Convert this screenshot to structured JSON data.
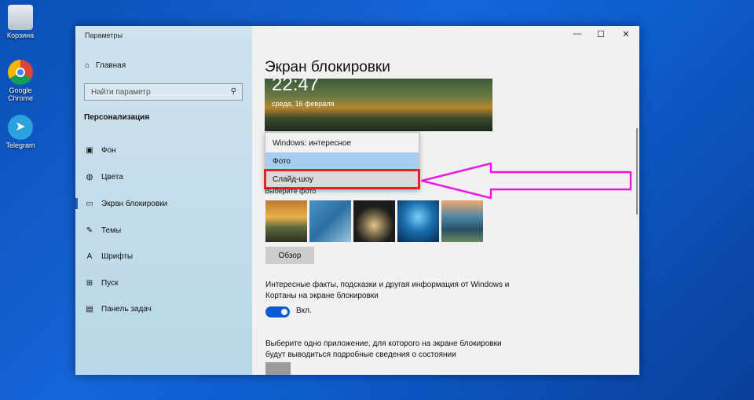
{
  "desktop": {
    "icons": [
      {
        "label": "Корзина"
      },
      {
        "label": "Google Chrome"
      },
      {
        "label": "Telegram"
      }
    ]
  },
  "window": {
    "app_title": "Параметры",
    "controls": {
      "minimize": "—",
      "maximize": "☐",
      "close": "✕"
    }
  },
  "sidebar": {
    "home_label": "Главная",
    "search_placeholder": "Найти параметр",
    "section_title": "Персонализация",
    "items": [
      {
        "label": "Фон",
        "icon": "picture-icon"
      },
      {
        "label": "Цвета",
        "icon": "palette-icon"
      },
      {
        "label": "Экран блокировки",
        "icon": "lock-screen-icon",
        "active": true
      },
      {
        "label": "Темы",
        "icon": "themes-icon"
      },
      {
        "label": "Шрифты",
        "icon": "fonts-icon"
      },
      {
        "label": "Пуск",
        "icon": "start-icon"
      },
      {
        "label": "Панель задач",
        "icon": "taskbar-icon"
      }
    ]
  },
  "main": {
    "page_title": "Экран блокировки",
    "preview": {
      "time": "22:47",
      "date": "среда, 16 февраля"
    },
    "background_dropdown": {
      "options": [
        "Windows: интересное",
        "Фото",
        "Слайд-шоу"
      ],
      "selected": "Фото",
      "hovered": "Слайд-шоу"
    },
    "choose_photo_label": "Выберите фото",
    "browse_button": "Обзор",
    "fun_facts_text": "Интересные факты, подсказки и другая информация от Windows и Кортаны на экране блокировки",
    "fun_facts_toggle": {
      "state": "Вкл."
    },
    "detailed_status_text": "Выберите одно приложение, для которого на экране блокировки будут выводиться подробные сведения о состоянии"
  },
  "colors": {
    "accent": "#0a5bd3",
    "annotation_arrow": "#e81ce0",
    "highlight_box": "#e2232a"
  }
}
